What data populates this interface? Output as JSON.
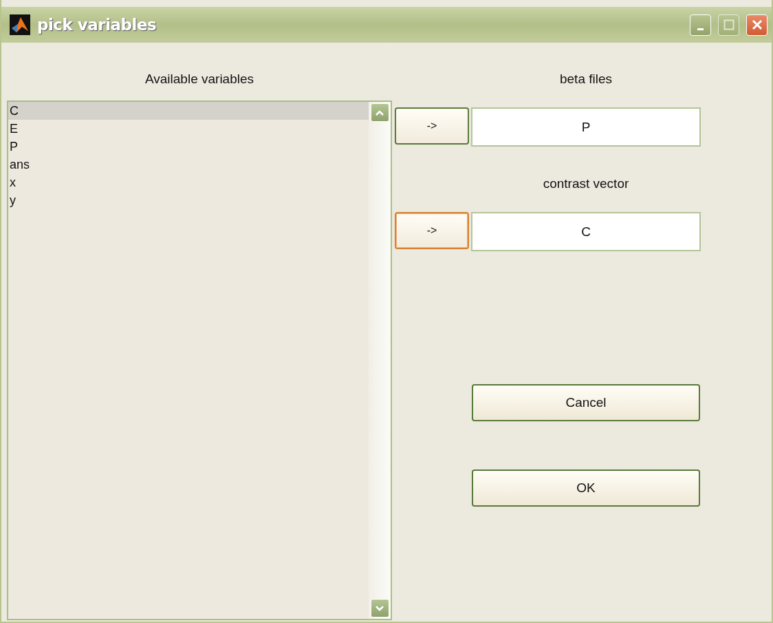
{
  "window": {
    "title": "pick variables"
  },
  "available": {
    "label": "Available variables",
    "items": [
      {
        "name": "C",
        "selected": true
      },
      {
        "name": "E",
        "selected": false
      },
      {
        "name": "P",
        "selected": false
      },
      {
        "name": "ans",
        "selected": false
      },
      {
        "name": "x",
        "selected": false
      },
      {
        "name": "y",
        "selected": false
      }
    ]
  },
  "targets": [
    {
      "label": "beta files",
      "button": "->",
      "value": "P",
      "focused": false
    },
    {
      "label": "contrast vector",
      "button": "->",
      "value": "C",
      "focused": true
    }
  ],
  "buttons": [
    "Cancel",
    "OK"
  ]
}
